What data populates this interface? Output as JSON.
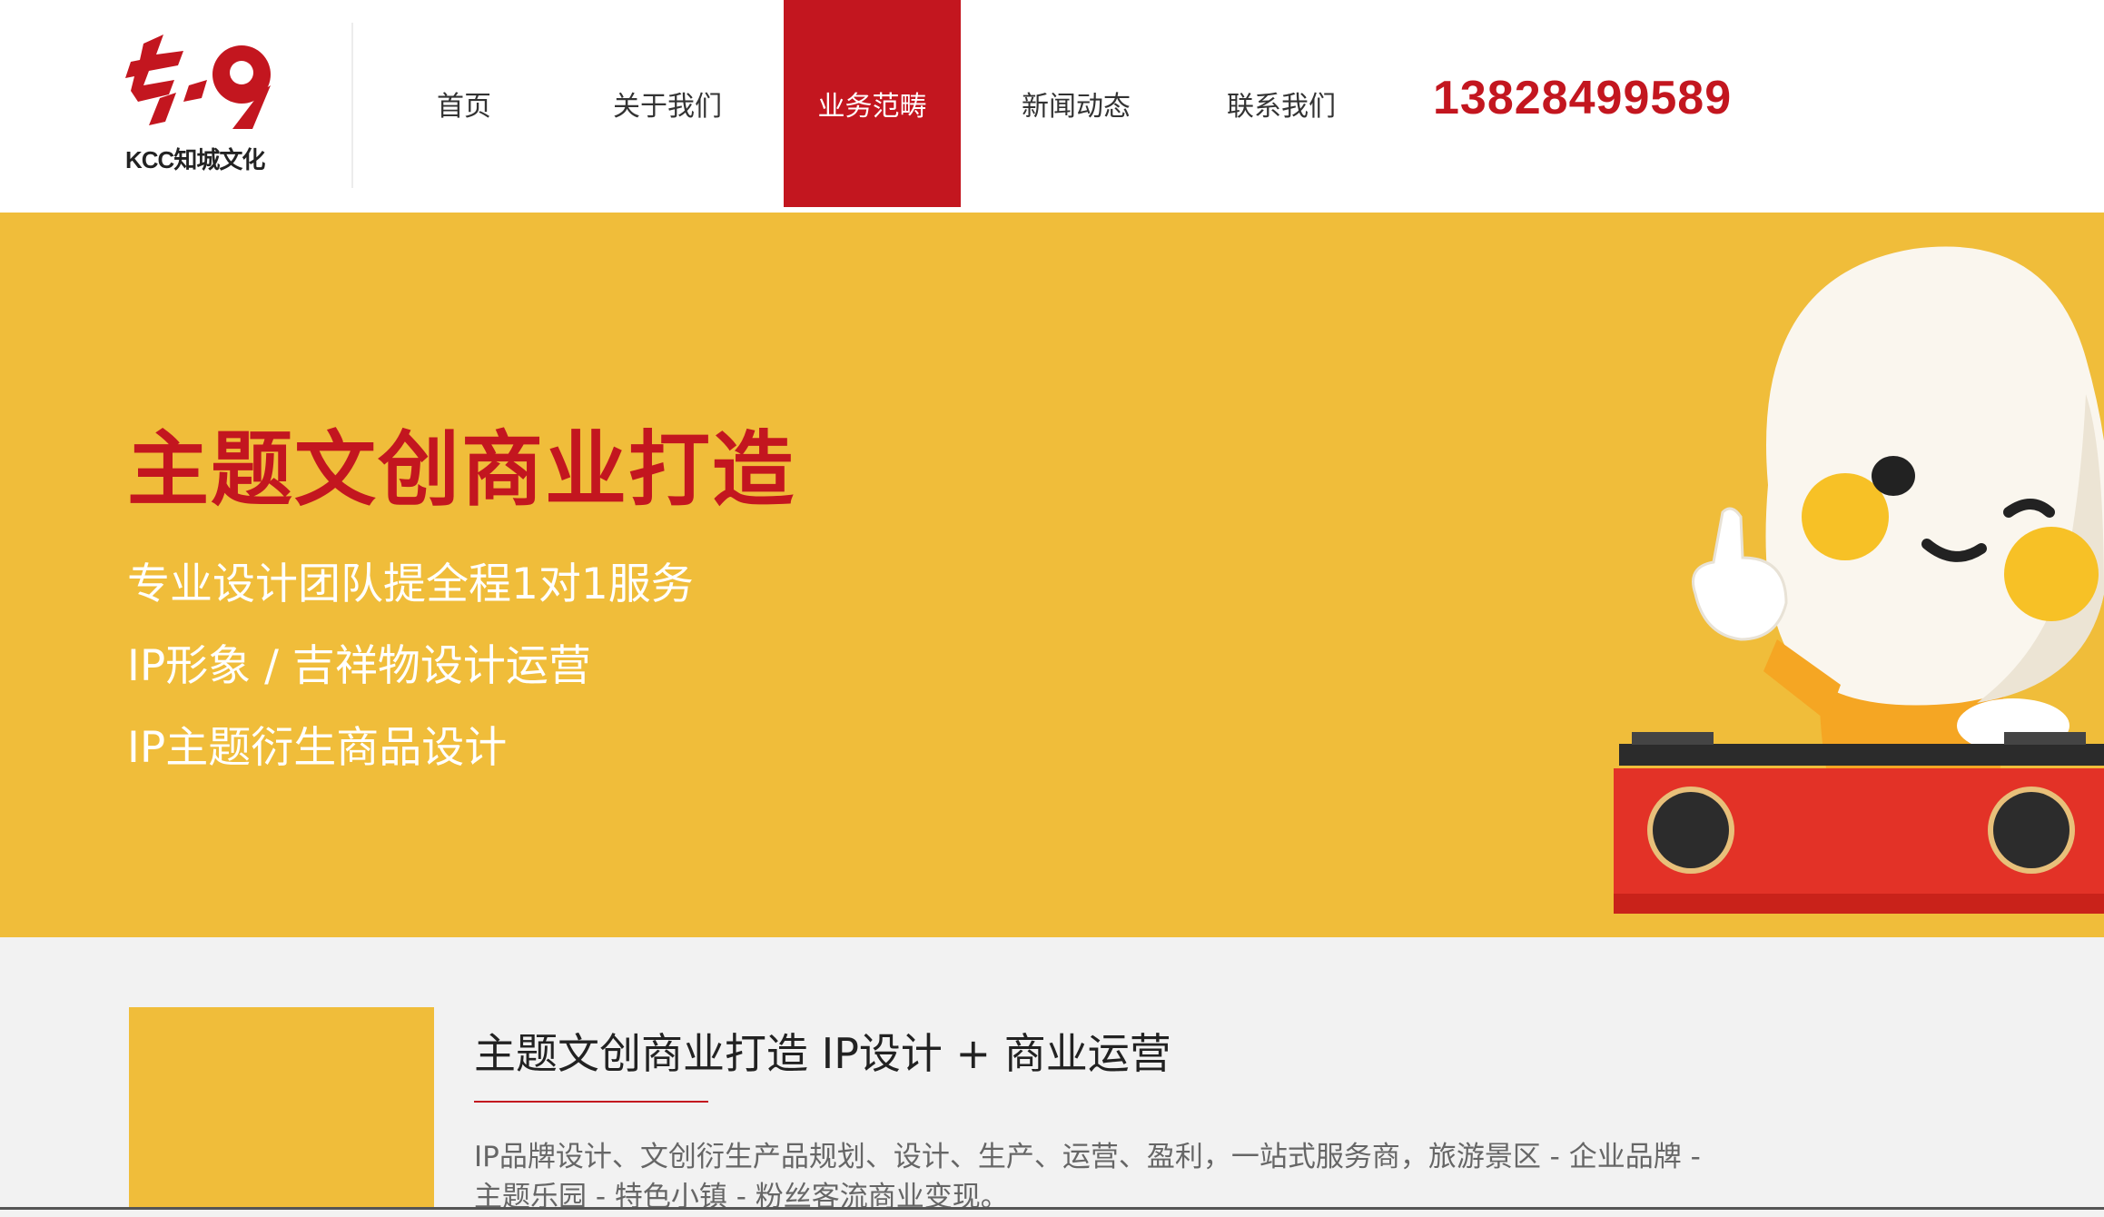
{
  "brand": {
    "logo_text": "KCC知城文化",
    "primary_color": "#c3161f",
    "accent_color": "#f0bd3a"
  },
  "nav": {
    "items": [
      {
        "label": "首页",
        "active": false
      },
      {
        "label": "关于我们",
        "active": false
      },
      {
        "label": "业务范畴",
        "active": true
      },
      {
        "label": "新闻动态",
        "active": false
      },
      {
        "label": "联系我们",
        "active": false
      }
    ],
    "phone": "13828499589"
  },
  "banner": {
    "title": "主题文创商业打造",
    "lines": [
      "专业设计团队提全程1对1服务",
      "IP形象 / 吉祥物设计运营",
      "IP主题衍生商品设计"
    ],
    "image": "mascot-dj-character"
  },
  "intro": {
    "title": "主题文创商业打造 IP设计 + 商业运营",
    "description": "IP品牌设计、文创衍生产品规划、设计、生产、运营、盈利，一站式服务商，旅游景区 - 企业品牌 - 主题乐园 - 特色小镇 - 粉丝客流商业变现。"
  }
}
